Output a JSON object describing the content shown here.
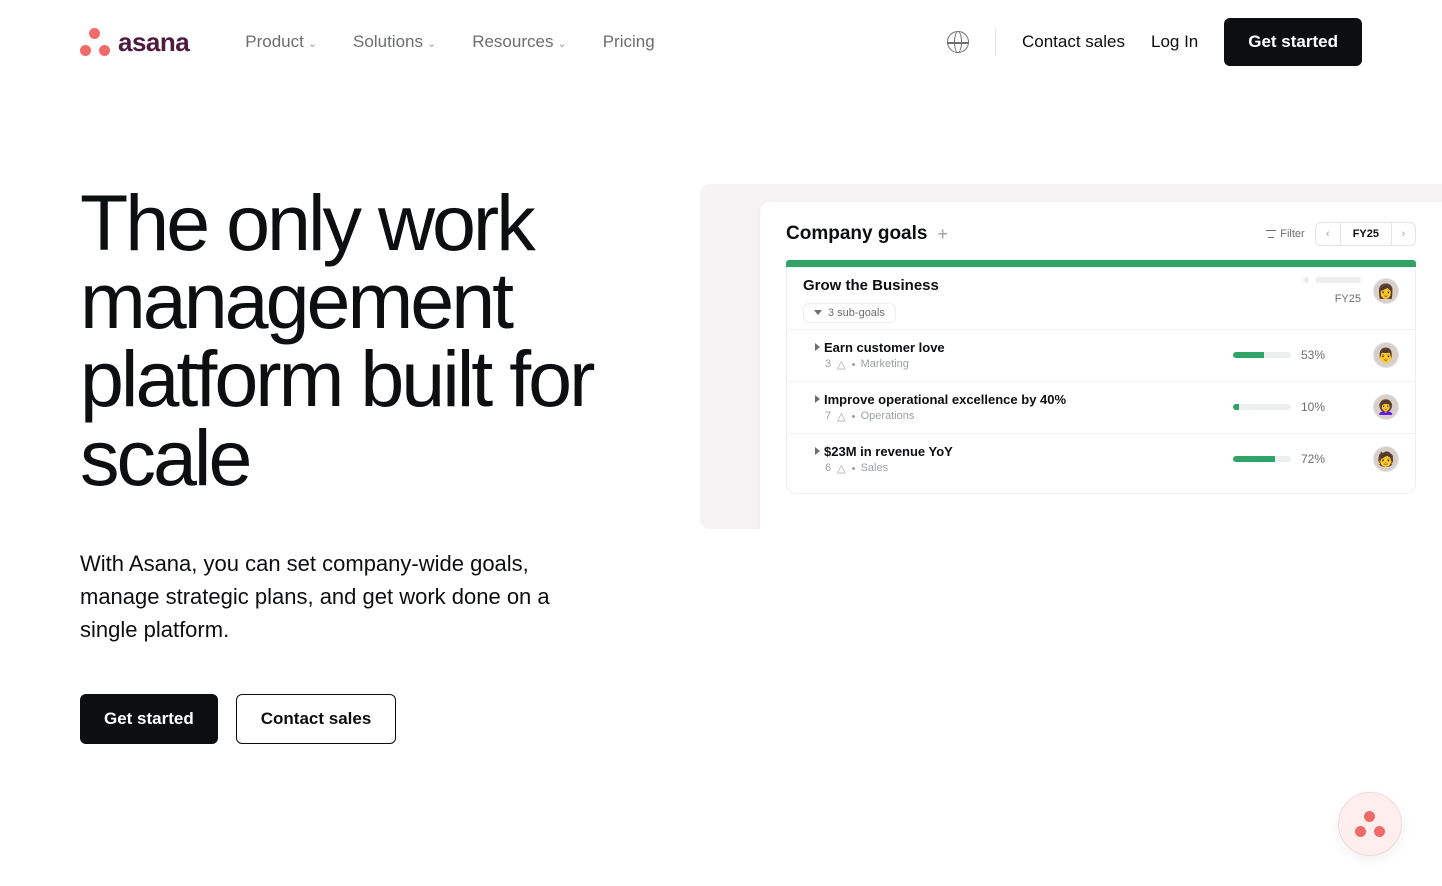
{
  "brand": {
    "name": "asana"
  },
  "nav": {
    "items": [
      {
        "label": "Product",
        "hasMenu": true
      },
      {
        "label": "Solutions",
        "hasMenu": true
      },
      {
        "label": "Resources",
        "hasMenu": true
      },
      {
        "label": "Pricing",
        "hasMenu": false
      }
    ],
    "contact": "Contact sales",
    "login": "Log In",
    "cta": "Get started"
  },
  "hero": {
    "title": "The only work management platform built for scale",
    "subtitle": "With Asana, you can set company-wide goals, manage strategic plans, and get work done on a single platform.",
    "primary": "Get started",
    "secondary": "Contact sales"
  },
  "preview": {
    "title": "Company goals",
    "filter_label": "Filter",
    "period": "FY25",
    "main_goal": {
      "title": "Grow the Business",
      "subgoals_label": "3 sub-goals",
      "period": "FY25"
    },
    "rows": [
      {
        "title": "Earn customer love",
        "count": "3",
        "dept": "Marketing",
        "pct": 53
      },
      {
        "title": "Improve operational excellence by 40%",
        "count": "7",
        "dept": "Operations",
        "pct": 10
      },
      {
        "title": "$23M in revenue YoY",
        "count": "6",
        "dept": "Sales",
        "pct": 72
      }
    ]
  }
}
